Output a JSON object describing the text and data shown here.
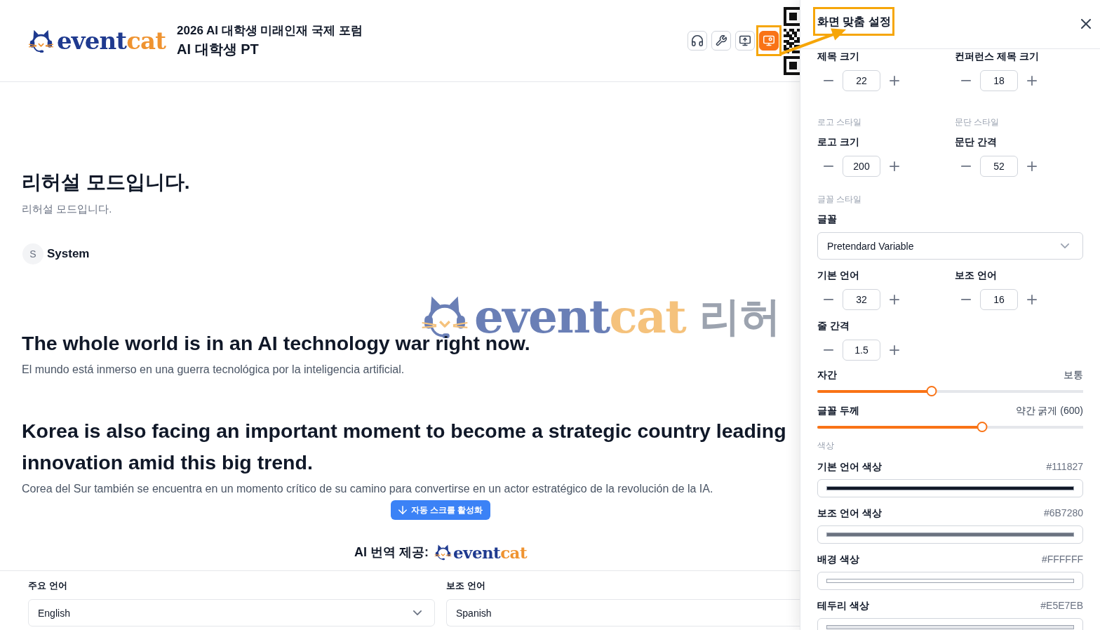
{
  "header": {
    "logo": {
      "wordmark": [
        "event",
        "cat"
      ]
    },
    "event_title": "2026 AI 대학생 미래인재 국제 포럼",
    "session_title": "AI 대학생 PT",
    "toolbar": [
      {
        "selected": false
      },
      {
        "selected": false
      },
      {
        "selected": false
      },
      {
        "selected": true
      }
    ]
  },
  "watermark": {
    "wordmark": [
      "event",
      "cat"
    ],
    "label": "리허"
  },
  "notice": {
    "title": "리허설 모드입니다.",
    "text": "리허설 모드입니다."
  },
  "speaker": {
    "initial": "S",
    "name": "System"
  },
  "segments": [
    {
      "primary": "The whole world is in an AI technology war right now.",
      "secondary": "El mundo está inmerso en una guerra tecnológica por la inteligencia artificial."
    },
    {
      "primary": "Korea is also facing an important moment to become a strategic country leading innovation amid this big trend.",
      "secondary": "Corea del Sur también se encuentra en un momento crítico de su camino para convertirse en un actor estratégico de la revolución de la IA."
    }
  ],
  "auto_scroll_button": {
    "label": "자동 스크롤 활성화"
  },
  "credit": {
    "label": "AI 번역 제공:",
    "wordmark": [
      "event",
      "cat"
    ]
  },
  "language_bar": [
    {
      "label": "주요 언어",
      "value": "English",
      "cut_off": false
    },
    {
      "label": "보조 언어",
      "value": "Spanish",
      "cut_off": true
    }
  ],
  "settings_panel": {
    "title": "화면 맞춤 설정",
    "controls": [
      {
        "kind": "stepper_pair",
        "items": [
          {
            "label": "제목 크기",
            "value": "22"
          },
          {
            "label": "컨퍼런스 제목 크기",
            "value": "18"
          }
        ]
      },
      {
        "kind": "stepper_pair",
        "items": [
          {
            "section": "로고 스타일",
            "label": "로고 크기",
            "value": "200"
          },
          {
            "section": "문단 스타일",
            "label": "문단 간격",
            "value": "52"
          }
        ]
      },
      {
        "kind": "section",
        "text": "글꼴 스타일"
      },
      {
        "kind": "select",
        "label": "글꼴",
        "value": "Pretendard Variable"
      },
      {
        "kind": "stepper_pair",
        "items": [
          {
            "label": "기본 언어",
            "value": "32"
          },
          {
            "label": "보조 언어",
            "value": "16"
          }
        ]
      },
      {
        "kind": "stepper_pair",
        "items": [
          {
            "label": "줄 간격",
            "value": "1.5"
          }
        ]
      },
      {
        "kind": "slider",
        "label": "자간",
        "reading": "보통",
        "level": 0.43
      },
      {
        "kind": "slider",
        "label": "글꼴 두께",
        "reading": "약간 굵게 (600)",
        "level": 0.62
      },
      {
        "kind": "section",
        "text": "색상"
      },
      {
        "kind": "color",
        "label": "기본 언어 색상",
        "value": "#111827",
        "color": "#111827"
      },
      {
        "kind": "color",
        "label": "보조 언어 색상",
        "value": "#6B7280",
        "color": "#6b7280"
      },
      {
        "kind": "color",
        "label": "배경 색상",
        "value": "#FFFFFF",
        "color": "#ffffff"
      },
      {
        "kind": "color",
        "label": "테두리 색상",
        "value": "#E5E7EB",
        "color": "#e5e7eb"
      }
    ]
  }
}
